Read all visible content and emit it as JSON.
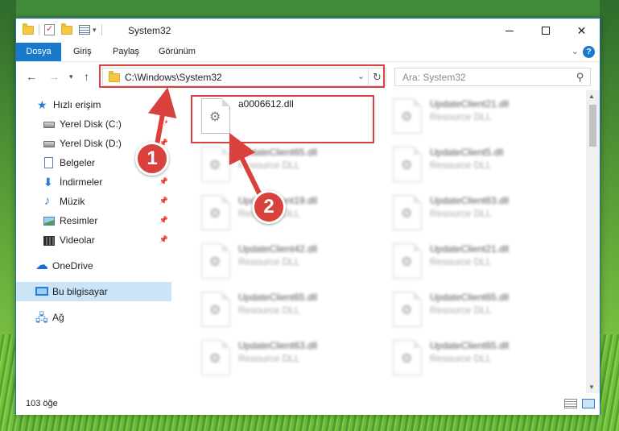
{
  "window": {
    "title": "System32"
  },
  "ribbon": {
    "tabs": [
      "Dosya",
      "Giriş",
      "Paylaş",
      "Görünüm"
    ],
    "help": "?"
  },
  "navigation": {
    "address": "C:\\Windows\\System32",
    "search_placeholder": "Ara: System32"
  },
  "sidebar": {
    "items": [
      {
        "label": "Hızlı erişim",
        "icon": "star-icon"
      },
      {
        "label": "Yerel Disk (C:)",
        "icon": "disk-icon",
        "pinned": true
      },
      {
        "label": "Yerel Disk (D:)",
        "icon": "disk-icon",
        "pinned": true
      },
      {
        "label": "Belgeler",
        "icon": "document-icon",
        "pinned": true
      },
      {
        "label": "İndirmeler",
        "icon": "download-icon",
        "pinned": true
      },
      {
        "label": "Müzik",
        "icon": "music-icon",
        "pinned": true
      },
      {
        "label": "Resimler",
        "icon": "pictures-icon",
        "pinned": true
      },
      {
        "label": "Videolar",
        "icon": "video-icon",
        "pinned": true
      },
      {
        "label": "OneDrive",
        "icon": "cloud-icon"
      },
      {
        "label": "Bu bilgisayar",
        "icon": "computer-icon",
        "selected": true
      },
      {
        "label": "Ağ",
        "icon": "network-icon"
      }
    ]
  },
  "files": [
    {
      "name": "a0006612.dll",
      "type": ""
    },
    {
      "name": "UpdateClient21.dll",
      "type": "Resource DLL"
    },
    {
      "name": "UpdateClient65.dll",
      "type": "Resource DLL"
    },
    {
      "name": "UpdateClient5.dll",
      "type": "Resource DLL"
    },
    {
      "name": "UpdateClient19.dll",
      "type": "Resource DLL"
    },
    {
      "name": "UpdateClient63.dll",
      "type": "Resource DLL"
    },
    {
      "name": "UpdateClient42.dll",
      "type": "Resource DLL"
    },
    {
      "name": "UpdateClient21.dll",
      "type": "Resource DLL"
    },
    {
      "name": "UpdateClient65.dll",
      "type": "Resource DLL"
    },
    {
      "name": "UpdateClient65.dll",
      "type": "Resource DLL"
    },
    {
      "name": "UpdateClient63.dll",
      "type": "Resource DLL"
    },
    {
      "name": "UpdateClient65.dll",
      "type": "Resource DLL"
    }
  ],
  "status": {
    "item_count": "103 öğe"
  },
  "annotations": {
    "step1": "1",
    "step2": "2",
    "color": "#d9413c"
  },
  "colors": {
    "accent": "#1979ca",
    "selection": "#cce4f7"
  }
}
